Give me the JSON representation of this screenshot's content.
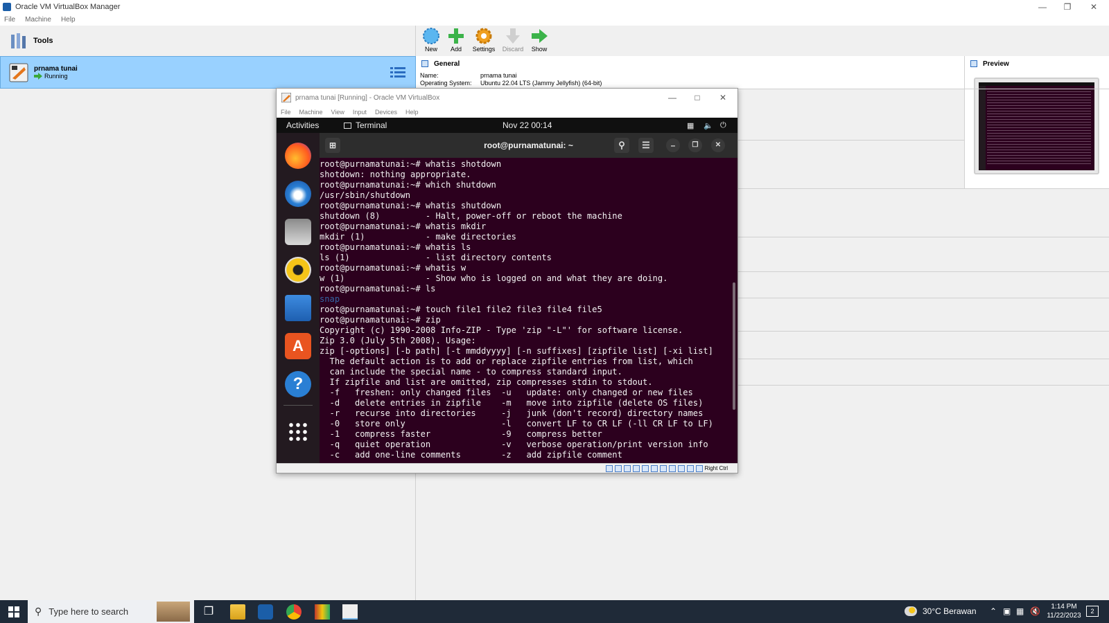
{
  "manager": {
    "title": "Oracle VM VirtualBox Manager",
    "menu": [
      "File",
      "Machine",
      "Help"
    ],
    "tools_label": "Tools",
    "vm_name": "prnama tunai",
    "vm_state": "Running",
    "toolbar": {
      "new": "New",
      "add": "Add",
      "settings": "Settings",
      "discard": "Discard",
      "show": "Show"
    },
    "general": {
      "heading": "General",
      "name_label": "Name:",
      "name_value": "prnama tunai",
      "os_label": "Operating System:",
      "os_value": "Ubuntu 22.04 LTS (Jammy Jellyfish) (64-bit)"
    },
    "preview_heading": "Preview"
  },
  "vm_window": {
    "title": "prnama tunai  [Running] - Oracle VM VirtualBox",
    "menu": [
      "File",
      "Machine",
      "View",
      "Input",
      "Devices",
      "Help"
    ],
    "host_key": "Right Ctrl"
  },
  "guest": {
    "activities": "Activities",
    "app_name": "Terminal",
    "clock": "Nov 22  00:14",
    "terminal_title": "root@purnamatunai: ~",
    "lines": [
      "root@purnamatunai:~# whatis shotdown",
      "shotdown: nothing appropriate.",
      "root@purnamatunai:~# which shutdown",
      "/usr/sbin/shutdown",
      "root@purnamatunai:~# whatis shutdown",
      "shutdown (8)         - Halt, power-off or reboot the machine",
      "root@purnamatunai:~# whatis mkdir",
      "mkdir (1)            - make directories",
      "root@purnamatunai:~# whatis ls",
      "ls (1)               - list directory contents",
      "root@purnamatunai:~# whatis w",
      "w (1)                - Show who is logged on and what they are doing.",
      "root@purnamatunai:~# ls",
      "snap",
      "root@purnamatunai:~# touch file1 file2 file3 file4 file5",
      "root@purnamatunai:~# zip",
      "Copyright (c) 1990-2008 Info-ZIP - Type 'zip \"-L\"' for software license.",
      "Zip 3.0 (July 5th 2008). Usage:",
      "zip [-options] [-b path] [-t mmddyyyy] [-n suffixes] [zipfile list] [-xi list]",
      "  The default action is to add or replace zipfile entries from list, which",
      "  can include the special name - to compress standard input.",
      "  If zipfile and list are omitted, zip compresses stdin to stdout.",
      "  -f   freshen: only changed files  -u   update: only changed or new files",
      "  -d   delete entries in zipfile    -m   move into zipfile (delete OS files)",
      "  -r   recurse into directories     -j   junk (don't record) directory names",
      "  -0   store only                   -l   convert LF to CR LF (-ll CR LF to LF)",
      "  -1   compress faster              -9   compress better",
      "  -q   quiet operation              -v   verbose operation/print version info",
      "  -c   add one-line comments        -z   add zipfile comment"
    ]
  },
  "taskbar": {
    "search_placeholder": "Type here to search",
    "weather": "30°C  Berawan",
    "time": "1:14 PM",
    "date": "11/22/2023",
    "notification_count": "2"
  }
}
